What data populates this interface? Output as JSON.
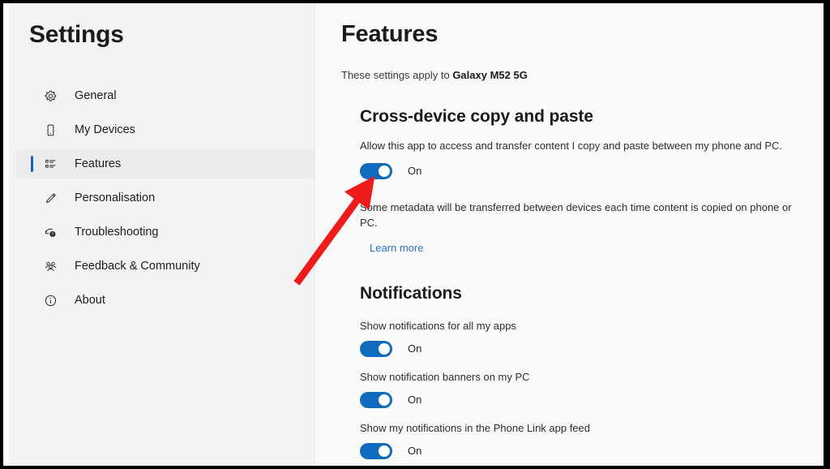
{
  "window": {
    "app_title": "Settings"
  },
  "sidebar": {
    "items": [
      {
        "label": "General",
        "icon": "gear-icon",
        "selected": false
      },
      {
        "label": "My Devices",
        "icon": "phone-icon",
        "selected": false
      },
      {
        "label": "Features",
        "icon": "list-icon",
        "selected": true
      },
      {
        "label": "Personalisation",
        "icon": "pen-icon",
        "selected": false
      },
      {
        "label": "Troubleshooting",
        "icon": "troubleshoot-icon",
        "selected": false
      },
      {
        "label": "Feedback & Community",
        "icon": "people-icon",
        "selected": false
      },
      {
        "label": "About",
        "icon": "info-icon",
        "selected": false
      }
    ]
  },
  "main": {
    "page_title": "Features",
    "applies_to_prefix": "These settings apply to ",
    "applies_to_device": "Galaxy M52 5G",
    "copy_paste": {
      "heading": "Cross-device copy and paste",
      "description": "Allow this app to access and transfer content I copy and paste between my phone and PC.",
      "toggle_state": "On",
      "note": "Some metadata will be transferred between devices each time content is copied on phone or PC.",
      "learn_more": "Learn more"
    },
    "notifications": {
      "heading": "Notifications",
      "items": [
        {
          "label": "Show notifications for all my apps",
          "toggle_state": "On"
        },
        {
          "label": "Show notification banners on my PC",
          "toggle_state": "On"
        },
        {
          "label": "Show my notifications in the Phone Link app feed",
          "toggle_state": "On"
        }
      ]
    }
  },
  "annotation": {
    "arrow_color": "#ee1b1b",
    "points_to": "cross-device-copy-paste-toggle"
  },
  "colors": {
    "accent": "#0f6cbd",
    "selection_bar": "#1565c0",
    "link": "#2f72c4",
    "sidebar_bg": "#f3f3f3",
    "content_bg": "#fafafa"
  }
}
